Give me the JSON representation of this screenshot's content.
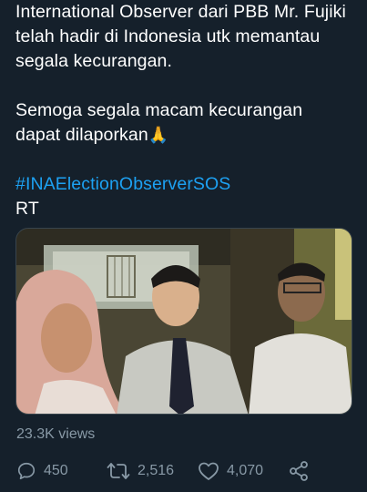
{
  "tweet": {
    "line1": "International Observer dari PBB Mr. Fujiki",
    "line2": "telah hadir di Indonesia utk memantau",
    "line3": "segala kecurangan.",
    "line4": "Semoga segala macam kecurangan",
    "line5": "dapat dilaporkan",
    "emoji": "🙏",
    "hashtag": "#INAElectionObserverSOS",
    "rt": "RT"
  },
  "media": {
    "kind": "video-thumbnail"
  },
  "stats": {
    "views": "23.3K views"
  },
  "actions": {
    "reply_count": "450",
    "retweet_count": "2,516",
    "like_count": "4,070"
  },
  "colors": {
    "background": "#15202b",
    "hashtag": "#1da1f2",
    "muted": "#8899a6"
  },
  "icons": {
    "reply": "reply-icon",
    "retweet": "retweet-icon",
    "like": "heart-icon",
    "share": "share-icon"
  }
}
